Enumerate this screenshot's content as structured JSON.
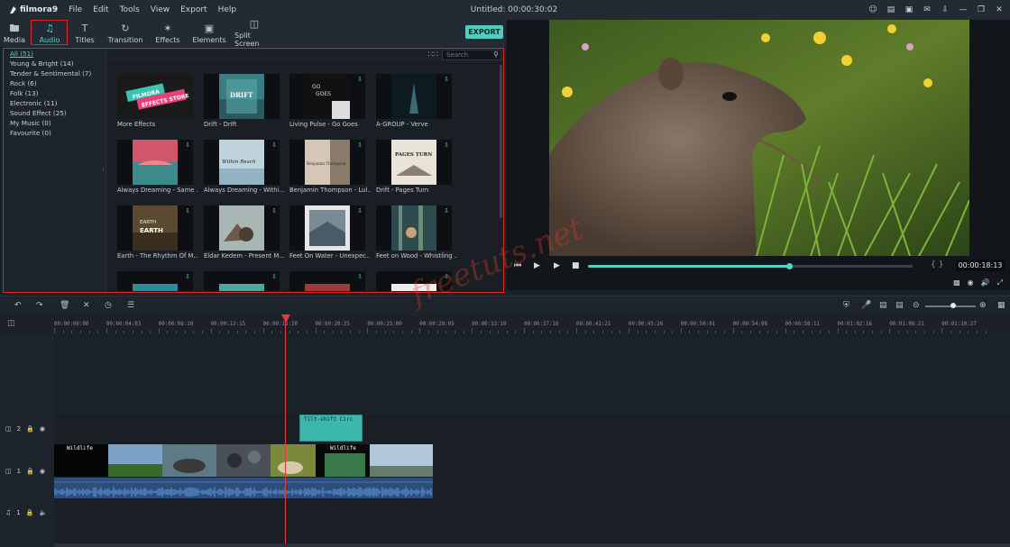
{
  "app": {
    "logo_text": "filmora9",
    "menus": [
      "File",
      "Edit",
      "Tools",
      "View",
      "Export",
      "Help"
    ],
    "title": "Untitled: 00:00:30:02"
  },
  "toolbar": {
    "tabs": [
      {
        "label": "Media",
        "icon": "folder-icon"
      },
      {
        "label": "Audio",
        "icon": "music-note-icon"
      },
      {
        "label": "Titles",
        "icon": "text-icon"
      },
      {
        "label": "Transition",
        "icon": "transition-icon"
      },
      {
        "label": "Effects",
        "icon": "sparkle-icon"
      },
      {
        "label": "Elements",
        "icon": "image-icon"
      },
      {
        "label": "Split Screen",
        "icon": "split-screen-icon"
      }
    ],
    "export_label": "EXPORT",
    "accent_color": "#57d2c5"
  },
  "library": {
    "categories": [
      "All (51)",
      "Young & Bright (14)",
      "Tender & Sentimental (7)",
      "Rock (6)",
      "Folk (13)",
      "Electronic (11)",
      "Sound Effect (25)",
      "My Music (0)",
      "Favourite (0)"
    ],
    "search_placeholder": "Search",
    "items": [
      "More Effects",
      "Drift - Drift",
      "Living Pulse - Go Goes",
      "A-GROUP - Verve",
      "Always Dreaming - Same ...",
      "Always Dreaming - Withi...",
      "Benjamin Thompson - Lul...",
      "Drift - Pages Turn",
      "Earth - The Rhythm Of M...",
      "Eldar Kedem - Present M...",
      "Feet On Water - Unexpec...",
      "Feet on Wood - Whistling ..."
    ],
    "thumb_texts": {
      "effects_store_1": "FILMORA",
      "effects_store_2": "EFFECTS STORE",
      "drift": "DRIFT",
      "go_goes_1": "GO",
      "go_goes_2": "GOES",
      "within_reach": "Within Reach",
      "benjamin": "Benjamin Thompson",
      "pages_turn": "PAGES TURN",
      "earth_1": "EARTH",
      "earth_2": "EARTH"
    }
  },
  "preview": {
    "timecode": "00:00:18:13",
    "progress_fraction": 0.62,
    "braces": "{    }"
  },
  "timeline": {
    "ruler_labels": [
      "00:00:00:00",
      "00:00:04:03",
      "00:00:08:10",
      "00:00:12:15",
      "00:00:16:20",
      "00:00:20:25",
      "00:00:25:00",
      "00:00:29:05",
      "00:00:33:10",
      "00:00:37:16",
      "00:00:41:21",
      "00:00:45:26",
      "00:00:50:01",
      "00:00:54:06",
      "00:00:58:11",
      "00:01:02:16",
      "00:01:06:21",
      "00:01:10:27"
    ],
    "tracks": [
      {
        "num": "2",
        "type": "video"
      },
      {
        "num": "1",
        "type": "video"
      },
      {
        "num": "1",
        "type": "audio"
      }
    ],
    "clips": {
      "effect_title": "Tilt-shift Circ",
      "video_title_1": "Wildlife",
      "video_title_2": "Wildlife"
    },
    "zoom_level": 0.55
  },
  "watermark": "freetuts.net"
}
